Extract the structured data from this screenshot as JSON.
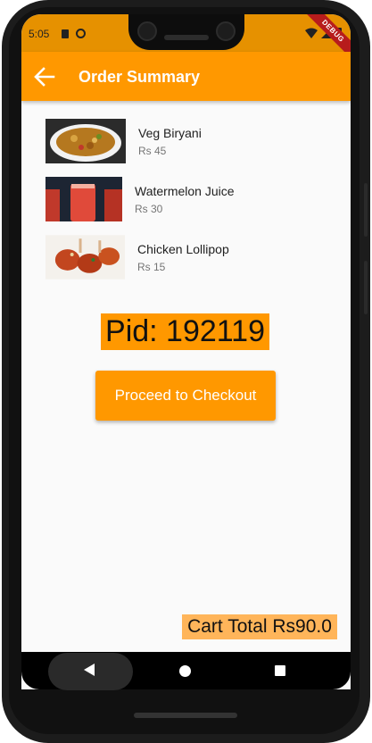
{
  "status_bar": {
    "time": "5:05"
  },
  "debug_label": "DEBUG",
  "app_bar": {
    "title": "Order Summary"
  },
  "items": [
    {
      "name": "Veg Biryani",
      "price": "Rs 45"
    },
    {
      "name": "Watermelon Juice",
      "price": "Rs 30"
    },
    {
      "name": "Chicken Lollipop",
      "price": "Rs 15"
    }
  ],
  "pid": "Pid: 192119",
  "checkout_label": "Proceed to Checkout",
  "cart_total": "Cart Total Rs90.0",
  "colors": {
    "accent": "#ff9800",
    "status_bar": "#e69100",
    "cart_total_bg": "#ffb55a"
  }
}
